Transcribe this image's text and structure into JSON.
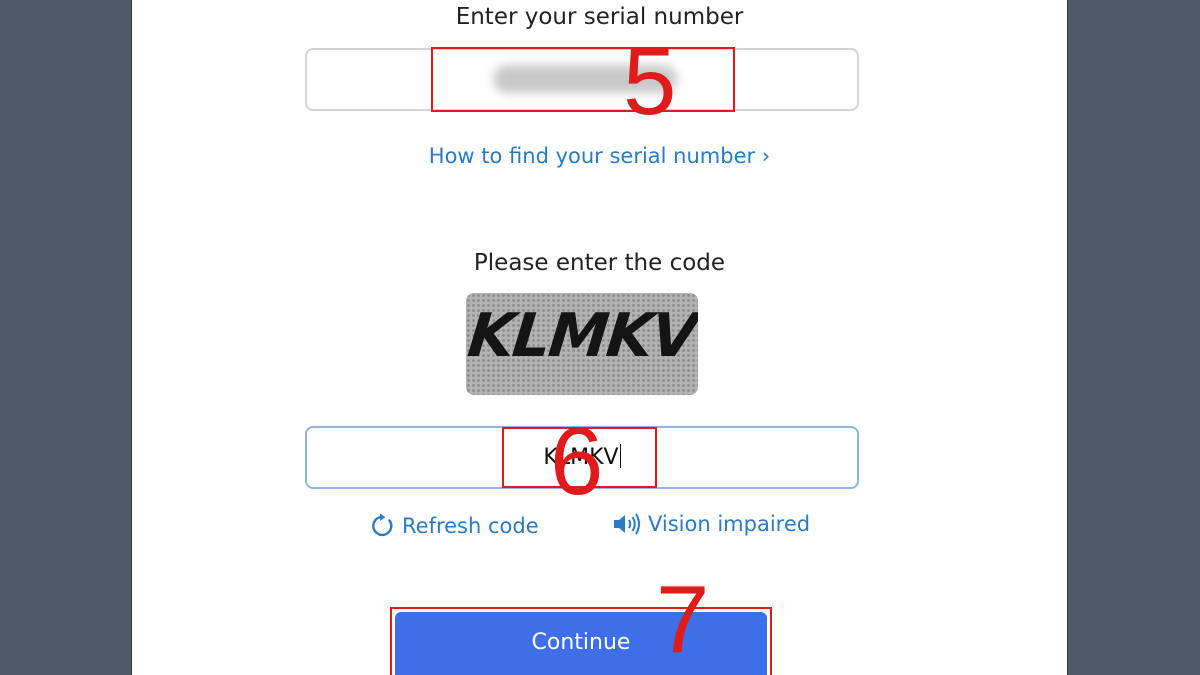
{
  "serial_section": {
    "heading": "Enter your serial number",
    "find_link": "How to find your serial number ›"
  },
  "code_section": {
    "heading": "Please enter the code",
    "captcha_text": "KLMKV",
    "input_value": "KLMKV",
    "refresh_label": "Refresh code",
    "vision_label": "Vision impaired"
  },
  "continue_button": {
    "label": "Continue"
  },
  "annotations": {
    "step_serial": "5",
    "step_code": "6",
    "step_continue": "7"
  },
  "colors": {
    "page_background": "#4d5b66",
    "link": "#2a7bc4",
    "button": "#3f6fe8",
    "highlight": "#e01b1b"
  },
  "icons": {
    "refresh": "refresh-icon",
    "vision": "speaker-icon"
  }
}
